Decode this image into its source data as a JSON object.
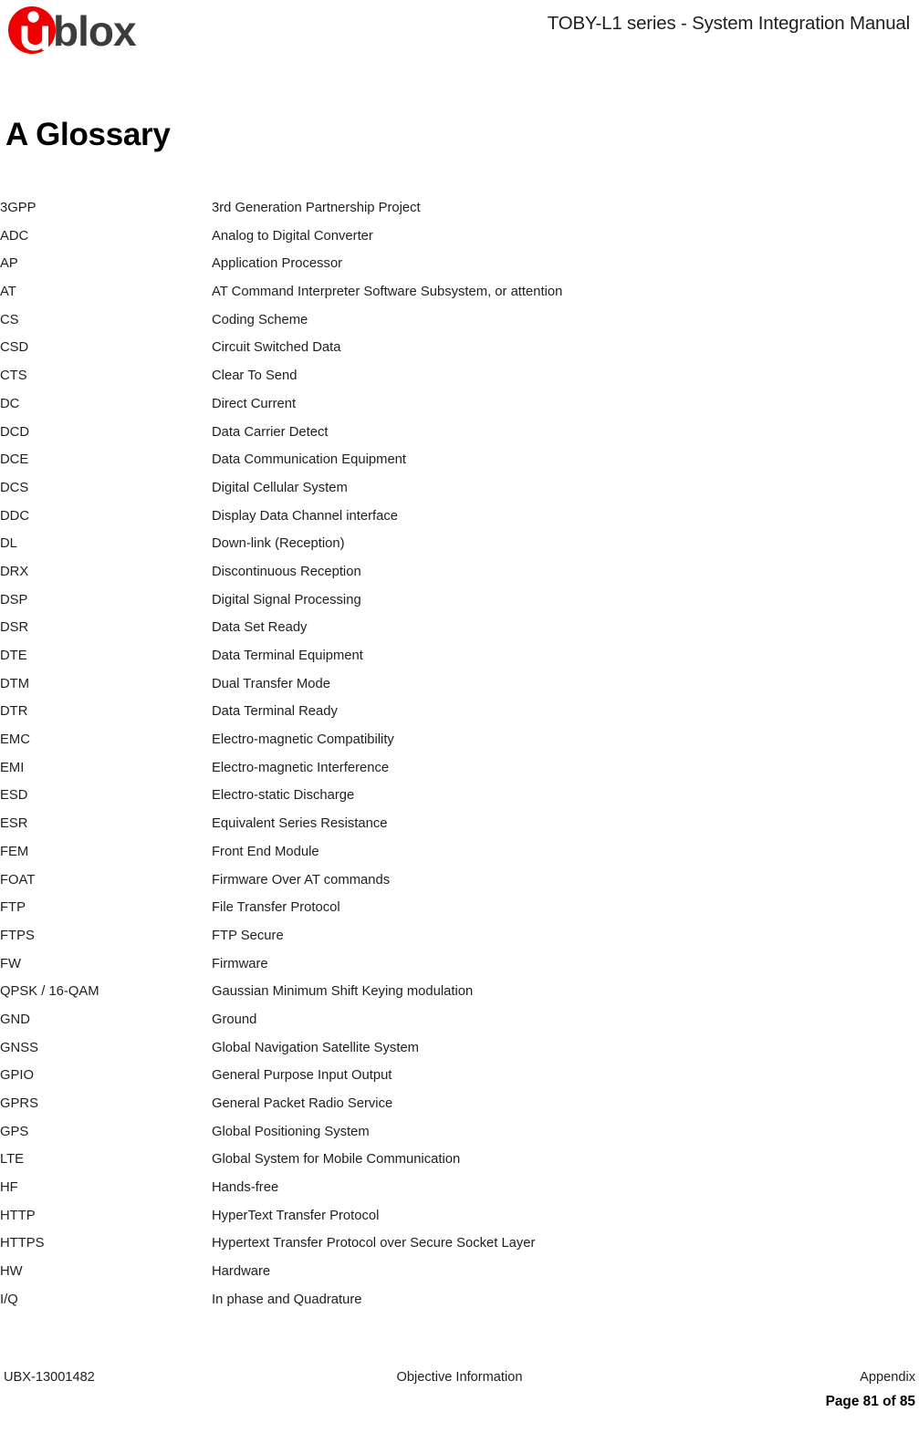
{
  "header": {
    "logo_alt": "u-blox",
    "logo_wordmark": "blox",
    "logo_red": "#EE0000",
    "logo_dark": "#3C3C3C",
    "title": "TOBY-L1 series - System Integration Manual"
  },
  "chapter": {
    "title": "A Glossary"
  },
  "glossary": {
    "entries": [
      {
        "term": "3GPP",
        "definition": "3rd Generation Partnership Project"
      },
      {
        "term": "ADC",
        "definition": "Analog to Digital Converter"
      },
      {
        "term": "AP",
        "definition": "Application Processor"
      },
      {
        "term": "AT",
        "definition": "AT Command Interpreter Software Subsystem, or attention"
      },
      {
        "term": "CS",
        "definition": "Coding Scheme"
      },
      {
        "term": "CSD",
        "definition": "Circuit Switched Data"
      },
      {
        "term": "CTS",
        "definition": "Clear To Send"
      },
      {
        "term": "DC",
        "definition": "Direct Current"
      },
      {
        "term": "DCD",
        "definition": "Data Carrier Detect"
      },
      {
        "term": "DCE",
        "definition": "Data Communication Equipment"
      },
      {
        "term": "DCS",
        "definition": "Digital Cellular System"
      },
      {
        "term": "DDC",
        "definition": "Display Data Channel interface"
      },
      {
        "term": "DL",
        "definition": "Down-link (Reception)"
      },
      {
        "term": "DRX",
        "definition": "Discontinuous Reception"
      },
      {
        "term": "DSP",
        "definition": "Digital Signal Processing"
      },
      {
        "term": "DSR",
        "definition": "Data Set Ready"
      },
      {
        "term": "DTE",
        "definition": "Data Terminal Equipment"
      },
      {
        "term": "DTM",
        "definition": "Dual Transfer Mode"
      },
      {
        "term": "DTR",
        "definition": "Data Terminal Ready"
      },
      {
        "term": "EMC",
        "definition": "Electro-magnetic Compatibility"
      },
      {
        "term": "EMI",
        "definition": "Electro-magnetic Interference"
      },
      {
        "term": "ESD",
        "definition": "Electro-static Discharge"
      },
      {
        "term": "ESR",
        "definition": "Equivalent Series Resistance"
      },
      {
        "term": "FEM",
        "definition": "Front End Module"
      },
      {
        "term": "FOAT",
        "definition": "Firmware Over AT commands"
      },
      {
        "term": "FTP",
        "definition": "File Transfer Protocol"
      },
      {
        "term": "FTPS",
        "definition": "FTP Secure"
      },
      {
        "term": "FW",
        "definition": "Firmware"
      },
      {
        "term": "QPSK / 16-QAM",
        "definition": "Gaussian Minimum Shift Keying modulation"
      },
      {
        "term": "GND",
        "definition": "Ground"
      },
      {
        "term": "GNSS",
        "definition": "Global Navigation Satellite System"
      },
      {
        "term": "GPIO",
        "definition": "General Purpose Input Output"
      },
      {
        "term": "GPRS",
        "definition": "General Packet Radio Service"
      },
      {
        "term": "GPS",
        "definition": "Global Positioning System"
      },
      {
        "term": "LTE",
        "definition": "Global System for Mobile Communication"
      },
      {
        "term": "HF",
        "definition": "Hands-free"
      },
      {
        "term": "HTTP",
        "definition": "HyperText Transfer Protocol"
      },
      {
        "term": "HTTPS",
        "definition": "Hypertext Transfer Protocol over Secure Socket Layer"
      },
      {
        "term": "HW",
        "definition": "Hardware"
      },
      {
        "term": "I/Q",
        "definition": "In phase and Quadrature"
      }
    ]
  },
  "footer": {
    "doc_id": "UBX-13001482",
    "center": "Objective Information",
    "section": "Appendix",
    "page": "Page 81 of 85"
  }
}
